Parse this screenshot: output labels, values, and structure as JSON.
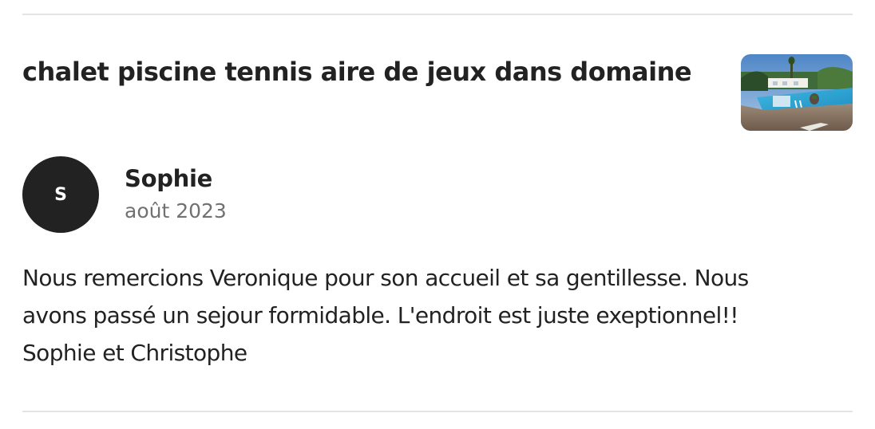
{
  "listing": {
    "title": "chalet piscine tennis aire de jeux dans domaine",
    "thumbnail_icon": "pool-photo"
  },
  "review": {
    "avatar_initial": "S",
    "reviewer_name": "Sophie",
    "date": "août 2023",
    "text_lines": [
      "Nous remercions Veronique pour son accueil et sa gentillesse. Nous",
      "avons passé un sejour formidable. L'endroit est juste exeptionnel!!",
      "Sophie et Christophe"
    ]
  },
  "colors": {
    "text": "#222222",
    "muted": "#717171",
    "divider": "#e4e4e4",
    "avatar_bg": "#222222"
  }
}
